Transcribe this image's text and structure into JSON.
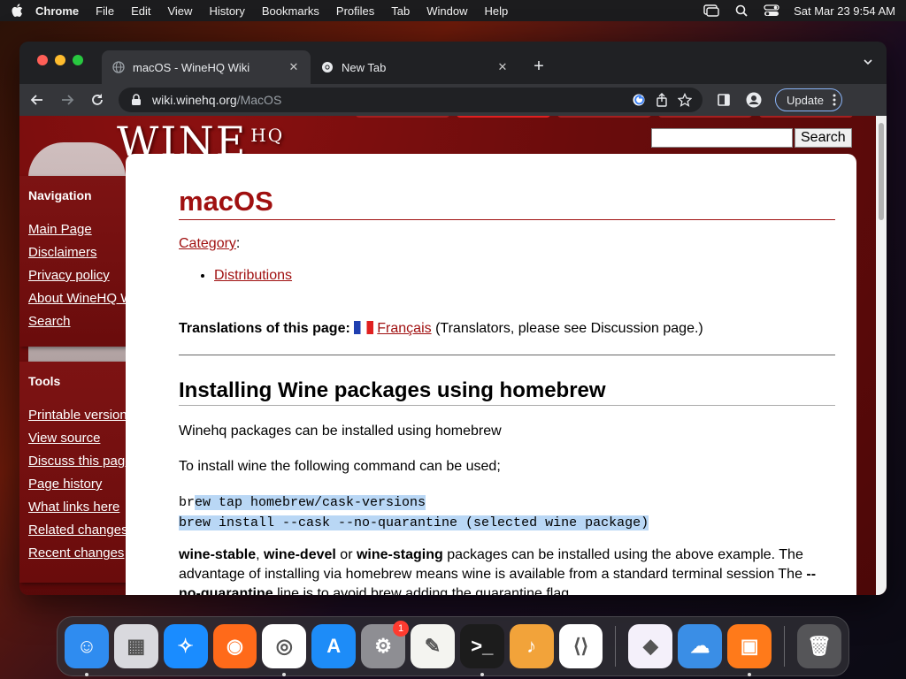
{
  "menubar": {
    "app_name": "Chrome",
    "items": [
      "File",
      "Edit",
      "View",
      "History",
      "Bookmarks",
      "Profiles",
      "Tab",
      "Window",
      "Help"
    ],
    "datetime": "Sat Mar 23  9:54 AM"
  },
  "browser": {
    "tabs": [
      {
        "title": "macOS - WineHQ Wiki",
        "active": true
      },
      {
        "title": "New Tab",
        "active": false
      }
    ],
    "url_host": "wiki.winehq.org",
    "url_path": "/MacOS",
    "update_label": "Update"
  },
  "site": {
    "logo_text": "WINE",
    "logo_sup": "HQ",
    "search_placeholder": "",
    "search_button": "Search"
  },
  "sidebar": {
    "navigation": {
      "heading": "Navigation",
      "links": [
        "Main Page",
        "Disclaimers",
        "Privacy policy",
        "About WineHQ Wiki",
        "Search"
      ]
    },
    "tools": {
      "heading": "Tools",
      "links": [
        "Printable version",
        "View source",
        "Discuss this page",
        "Page history",
        "What links here",
        "Related changes",
        "Recent changes"
      ]
    }
  },
  "article": {
    "title": "macOS",
    "category_label": "Category",
    "category_suffix": ":",
    "categories": [
      "Distributions"
    ],
    "translations_label": "Translations of this page:",
    "translation_link": "Français",
    "translations_note": "(Translators, please see Discussion page.)",
    "section_title": "Installing Wine packages using homebrew",
    "para1": "Winehq packages can be installed using homebrew",
    "para2": "To install wine the following command can be used;",
    "code_line1_prefix": "br",
    "code_line1_selected": "ew tap homebrew/cask-versions ",
    "code_line2": "brew install --cask --no-quarantine (selected wine package)",
    "para3_b1": "wine-stable",
    "para3_t1": ", ",
    "para3_b2": "wine-devel",
    "para3_t2": " or ",
    "para3_b3": "wine-staging",
    "para3_t3": " packages can be installed using the above example. The advantage of installing via homebrew means wine is available from a standard terminal session The ",
    "para3_b4": "--no-quarantine",
    "para3_t4": " line is to avoid brew adding the quarantine flag."
  },
  "dock": {
    "apps": [
      {
        "name": "finder",
        "color": "#2f8cf0",
        "glyph": "☺"
      },
      {
        "name": "launchpad",
        "color": "#d9d9de",
        "glyph": "▦"
      },
      {
        "name": "safari",
        "color": "#1a8cff",
        "glyph": "✧"
      },
      {
        "name": "firefox",
        "color": "#ff6a1a",
        "glyph": "◉"
      },
      {
        "name": "chrome",
        "color": "#ffffff",
        "glyph": "◎"
      },
      {
        "name": "app-store",
        "color": "#1d8cf8",
        "glyph": "A"
      },
      {
        "name": "system-settings",
        "color": "#8e8e93",
        "glyph": "⚙",
        "badge": "1"
      },
      {
        "name": "textedit",
        "color": "#f4f4f0",
        "glyph": "✎"
      },
      {
        "name": "terminal",
        "color": "#1c1c1c",
        "glyph": ">_"
      },
      {
        "name": "garageband",
        "color": "#f2a33a",
        "glyph": "♪"
      },
      {
        "name": "vscode",
        "color": "#ffffff",
        "glyph": "⟨⟩"
      },
      {
        "name": "visual-studio",
        "color": "#f4f0fa",
        "glyph": "◆"
      },
      {
        "name": "weather",
        "color": "#3a8ee6",
        "glyph": "☁"
      },
      {
        "name": "screen-recorder",
        "color": "#ff7a1a",
        "glyph": "▣"
      },
      {
        "name": "trash",
        "color": "#555558",
        "glyph": "🗑"
      }
    ]
  }
}
